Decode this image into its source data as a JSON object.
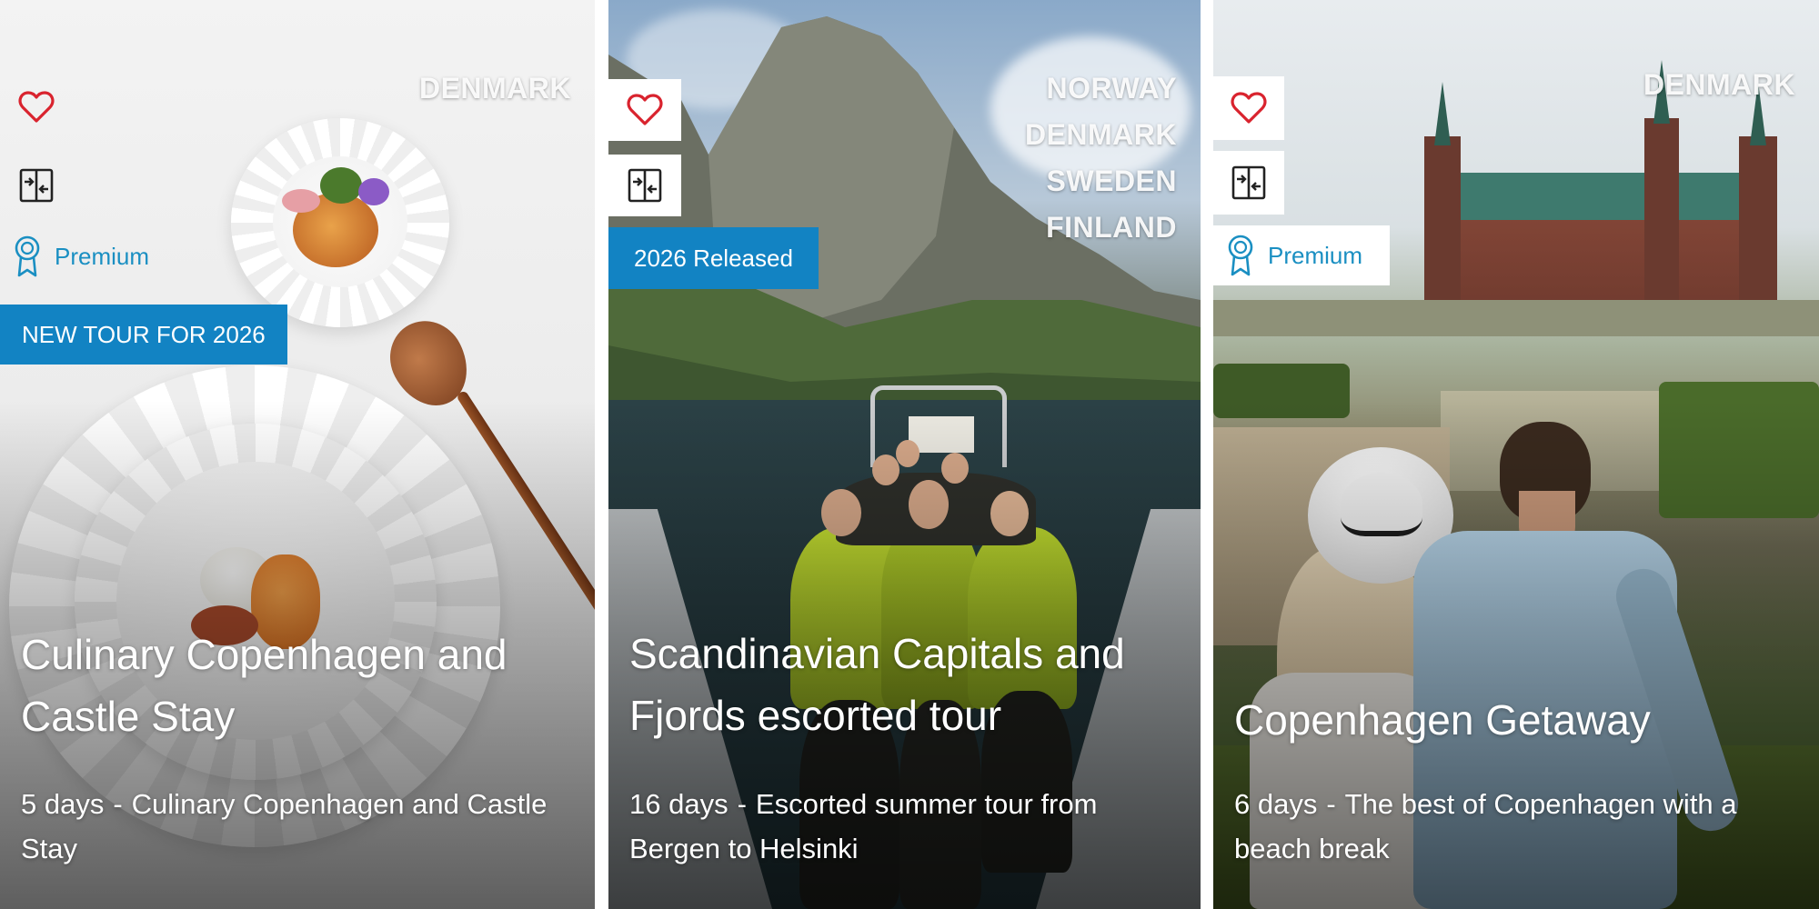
{
  "colors": {
    "accent_blue": "#1283c3",
    "premium_text": "#1a8fc2",
    "heart_red": "#d9232e"
  },
  "icons": {
    "favorite": "heart-icon",
    "compare": "compare-icon",
    "premium": "ribbon-award-icon"
  },
  "cards": [
    {
      "countries": [
        "DENMARK"
      ],
      "premium_label": "Premium",
      "tag": "NEW TOUR FOR 2026",
      "title": "Culinary Copenhagen and Castle Stay",
      "duration": "5 days",
      "separator": "-",
      "summary": "Culinary Copenhagen and Castle Stay"
    },
    {
      "countries": [
        "NORWAY",
        "DENMARK",
        "SWEDEN",
        "FINLAND"
      ],
      "tag": "2026 Released",
      "title": "Scandinavian Capitals and Fjords escorted tour",
      "duration": "16 days",
      "separator": "-",
      "summary": "Escorted summer tour from Bergen to Helsinki"
    },
    {
      "countries": [
        "DENMARK"
      ],
      "premium_label": "Premium",
      "title": "Copenhagen Getaway",
      "duration": "6 days",
      "separator": "-",
      "summary": "The best of Copenhagen with a beach break"
    }
  ]
}
